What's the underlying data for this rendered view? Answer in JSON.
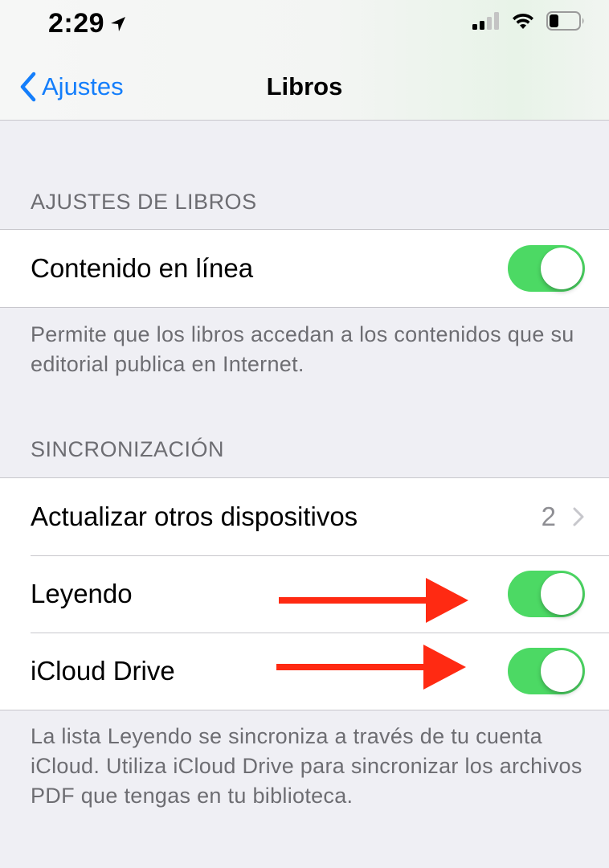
{
  "status_bar": {
    "time": "2:29",
    "icons": [
      "location-arrow-icon",
      "cellular-signal-icon",
      "wifi-icon",
      "battery-icon"
    ],
    "battery_level": 0.3
  },
  "nav": {
    "back_label": "Ajustes",
    "title": "Libros",
    "accent_color": "#147efb"
  },
  "sections": {
    "books": {
      "header": "AJUSTES DE LIBROS",
      "online_content": {
        "label": "Contenido en línea",
        "enabled": true
      },
      "footer": "Permite que los libros accedan a los contenidos que su editorial publica en Internet."
    },
    "sync": {
      "header": "SINCRONIZACIÓN",
      "update_devices": {
        "label": "Actualizar otros dispositivos",
        "value": "2"
      },
      "reading": {
        "label": "Leyendo",
        "enabled": true
      },
      "icloud_drive": {
        "label": "iCloud Drive",
        "enabled": true
      },
      "footer": "La lista Leyendo se sincroniza a través de tu cuenta iCloud. Utiliza iCloud Drive para sincronizar los archivos PDF que tengas en tu biblioteca."
    }
  },
  "colors": {
    "toggle_on": "#4cd964",
    "annotation_arrow": "#ff2a12"
  }
}
